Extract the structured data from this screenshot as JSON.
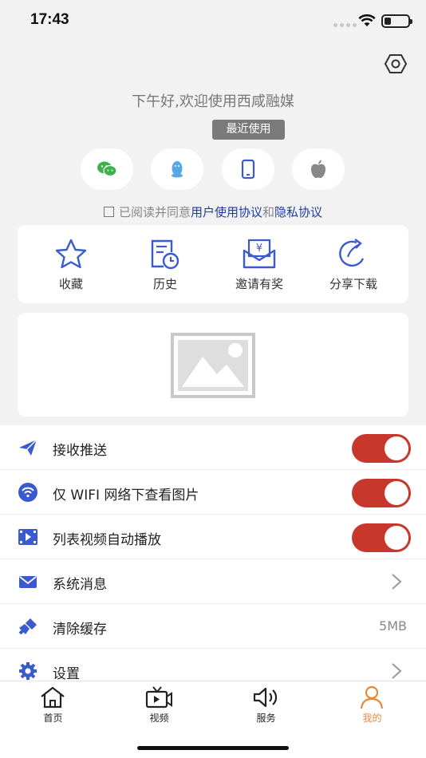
{
  "status_bar": {
    "time": "17:43"
  },
  "greeting": "下午好,欢迎使用西咸融媒",
  "recent_badge": "最近使用",
  "login_options": [
    {
      "icon": "wechat-icon",
      "color": "#3cb34a"
    },
    {
      "icon": "qq-icon",
      "color": "#58a8e8"
    },
    {
      "icon": "phone-icon",
      "color": "#3a5bd0"
    },
    {
      "icon": "apple-icon",
      "color": "#888888"
    }
  ],
  "agreement": {
    "prefix": "已阅读并同意",
    "user_agreement": "用户使用协议",
    "and": "和",
    "privacy": "隐私协议"
  },
  "quick_actions": [
    {
      "label": "收藏",
      "icon": "star-icon"
    },
    {
      "label": "历史",
      "icon": "history-icon"
    },
    {
      "label": "邀请有奖",
      "icon": "invite-reward-icon"
    },
    {
      "label": "分享下载",
      "icon": "share-icon"
    }
  ],
  "settings": [
    {
      "label": "接收推送",
      "icon": "send-icon",
      "control": "toggle",
      "on": true
    },
    {
      "label": "仅 WIFI 网络下查看图片",
      "icon": "wifi-icon",
      "control": "toggle",
      "on": true
    },
    {
      "label": "列表视频自动播放",
      "icon": "video-icon",
      "control": "toggle",
      "on": true
    },
    {
      "label": "系统消息",
      "icon": "mail-icon",
      "control": "chevron"
    },
    {
      "label": "清除缓存",
      "icon": "broom-icon",
      "control": "value",
      "value": "5MB"
    },
    {
      "label": "设置",
      "icon": "gear-icon",
      "control": "chevron"
    }
  ],
  "tabs": [
    {
      "label": "首页",
      "icon": "home-icon",
      "active": false
    },
    {
      "label": "视频",
      "icon": "tv-icon",
      "active": false
    },
    {
      "label": "服务",
      "icon": "speaker-icon",
      "active": false
    },
    {
      "label": "我的",
      "icon": "person-icon",
      "active": true
    }
  ],
  "colors": {
    "accent_blue": "#3a5bd0",
    "toggle_on": "#c7372b",
    "active_tab": "#e48a3b",
    "link": "#1f3ba7"
  }
}
